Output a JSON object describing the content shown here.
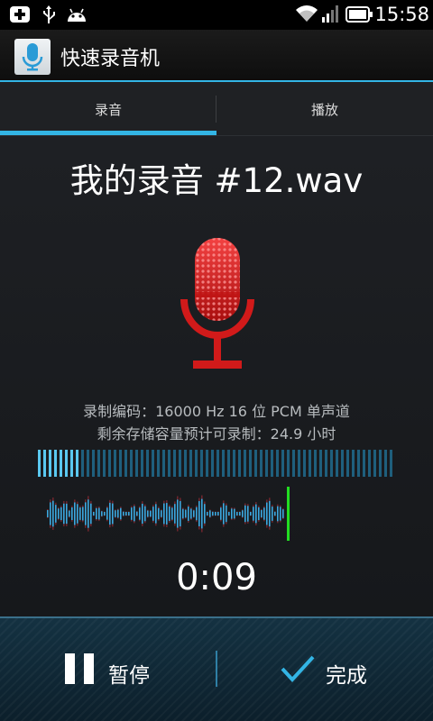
{
  "status_bar": {
    "time": "15:58",
    "icons": [
      "add-notification-icon",
      "usb-icon",
      "android-icon",
      "wifi-icon",
      "signal-icon",
      "battery-icon"
    ]
  },
  "app": {
    "title": "快速录音机",
    "icon": "microphone-icon"
  },
  "tabs": [
    {
      "label": "录音",
      "selected": true
    },
    {
      "label": "播放",
      "selected": false
    }
  ],
  "recording": {
    "filename": "我的录音 #12.wav",
    "encoding_info": "录制编码：16000 Hz 16 位 PCM 单声道",
    "storage_info": "剩余存储容量预计可录制：24.9 小时",
    "level_fraction": 0.12,
    "timer": "0:09"
  },
  "actions": {
    "pause_label": "暂停",
    "done_label": "完成"
  },
  "colors": {
    "accent": "#33b5e5",
    "mic_red": "#d11a1a",
    "wave_blue": "#3aa8e0",
    "wave_red": "#b0303a",
    "playhead": "#22dd22"
  }
}
